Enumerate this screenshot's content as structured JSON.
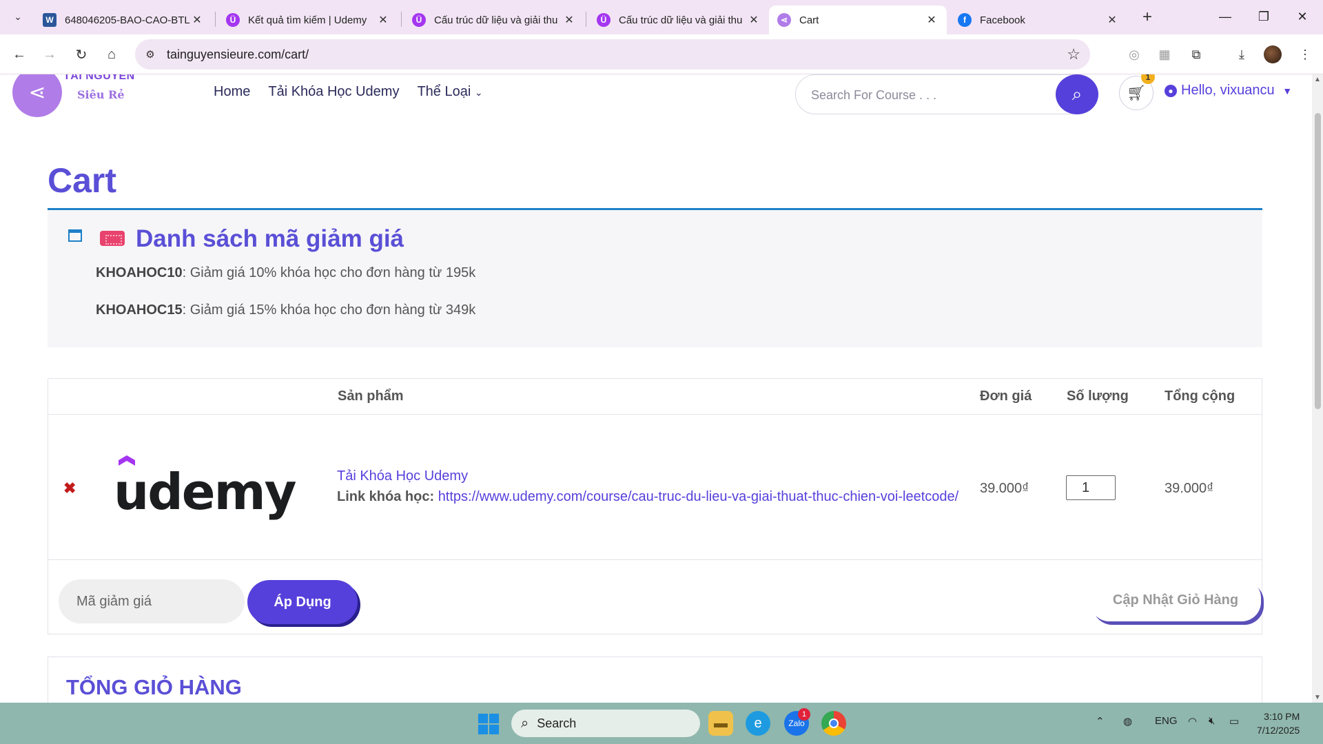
{
  "browser": {
    "tabs": [
      {
        "title": "648046205-BAO-CAO-BTL-",
        "favicon": "word-icon",
        "color": "#2b579a"
      },
      {
        "title": "Kết quả tìm kiếm | Udemy",
        "favicon": "udemy-icon",
        "color": "#a435f0"
      },
      {
        "title": "Cấu trúc dữ liệu và giải thu",
        "favicon": "udemy-icon",
        "color": "#a435f0"
      },
      {
        "title": "Cấu trúc dữ liệu và giải thu",
        "favicon": "udemy-icon",
        "color": "#a435f0"
      },
      {
        "title": "Cart",
        "favicon": "share-icon",
        "color": "#b07ce8",
        "active": true
      },
      {
        "title": "Facebook",
        "favicon": "facebook-icon",
        "color": "#1877f2"
      }
    ],
    "url": "tainguyensieure.com/cart/"
  },
  "site": {
    "logo_line1": "TÀI NGUYÊN",
    "logo_line2": "Siêu Rẻ",
    "nav": {
      "home": "Home",
      "udemy": "Tải Khóa Học Udemy",
      "categories": "Thể Loại"
    },
    "search_placeholder": "Search For Course . . .",
    "cart_count": "1",
    "greeting": "Hello, vixuancu"
  },
  "page": {
    "title": "Cart",
    "coupons": {
      "heading": "Danh sách mã giảm giá",
      "items": [
        {
          "code": "KHOAHOC10",
          "desc": ": Giảm giá 10% khóa học cho đơn hàng từ 195k"
        },
        {
          "code": "KHOAHOC15",
          "desc": ": Giảm giá 15% khóa học cho đơn hàng từ 349k"
        }
      ]
    },
    "table": {
      "headers": {
        "product": "Sản phẩm",
        "price": "Đơn giá",
        "qty": "Số lượng",
        "total": "Tổng cộng"
      },
      "rows": [
        {
          "remove": "✖",
          "logo_text": "udemy",
          "name": "Tải Khóa Học Udemy",
          "link_label": "Link khóa học:",
          "link": "https://www.udemy.com/course/cau-truc-du-lieu-va-giai-thuat-thuc-chien-voi-leetcode/",
          "price": "39.000₫",
          "qty": "1",
          "total": "39.000₫"
        }
      ],
      "coupon_placeholder": "Mã giảm giá",
      "apply_label": "Áp Dụng",
      "update_label": "Cập Nhật Giỏ Hàng"
    },
    "totals_heading": "TỔNG GIỎ HÀNG"
  },
  "taskbar": {
    "search_label": "Search",
    "zalo_badge": "1",
    "lang": "ENG",
    "time": "3:10 PM",
    "date": "7/12/2025"
  },
  "colors": {
    "accent": "#5640db",
    "heading": "#5a4fd6",
    "coupon_border": "#1e80c8",
    "remove": "#c21b1b"
  }
}
